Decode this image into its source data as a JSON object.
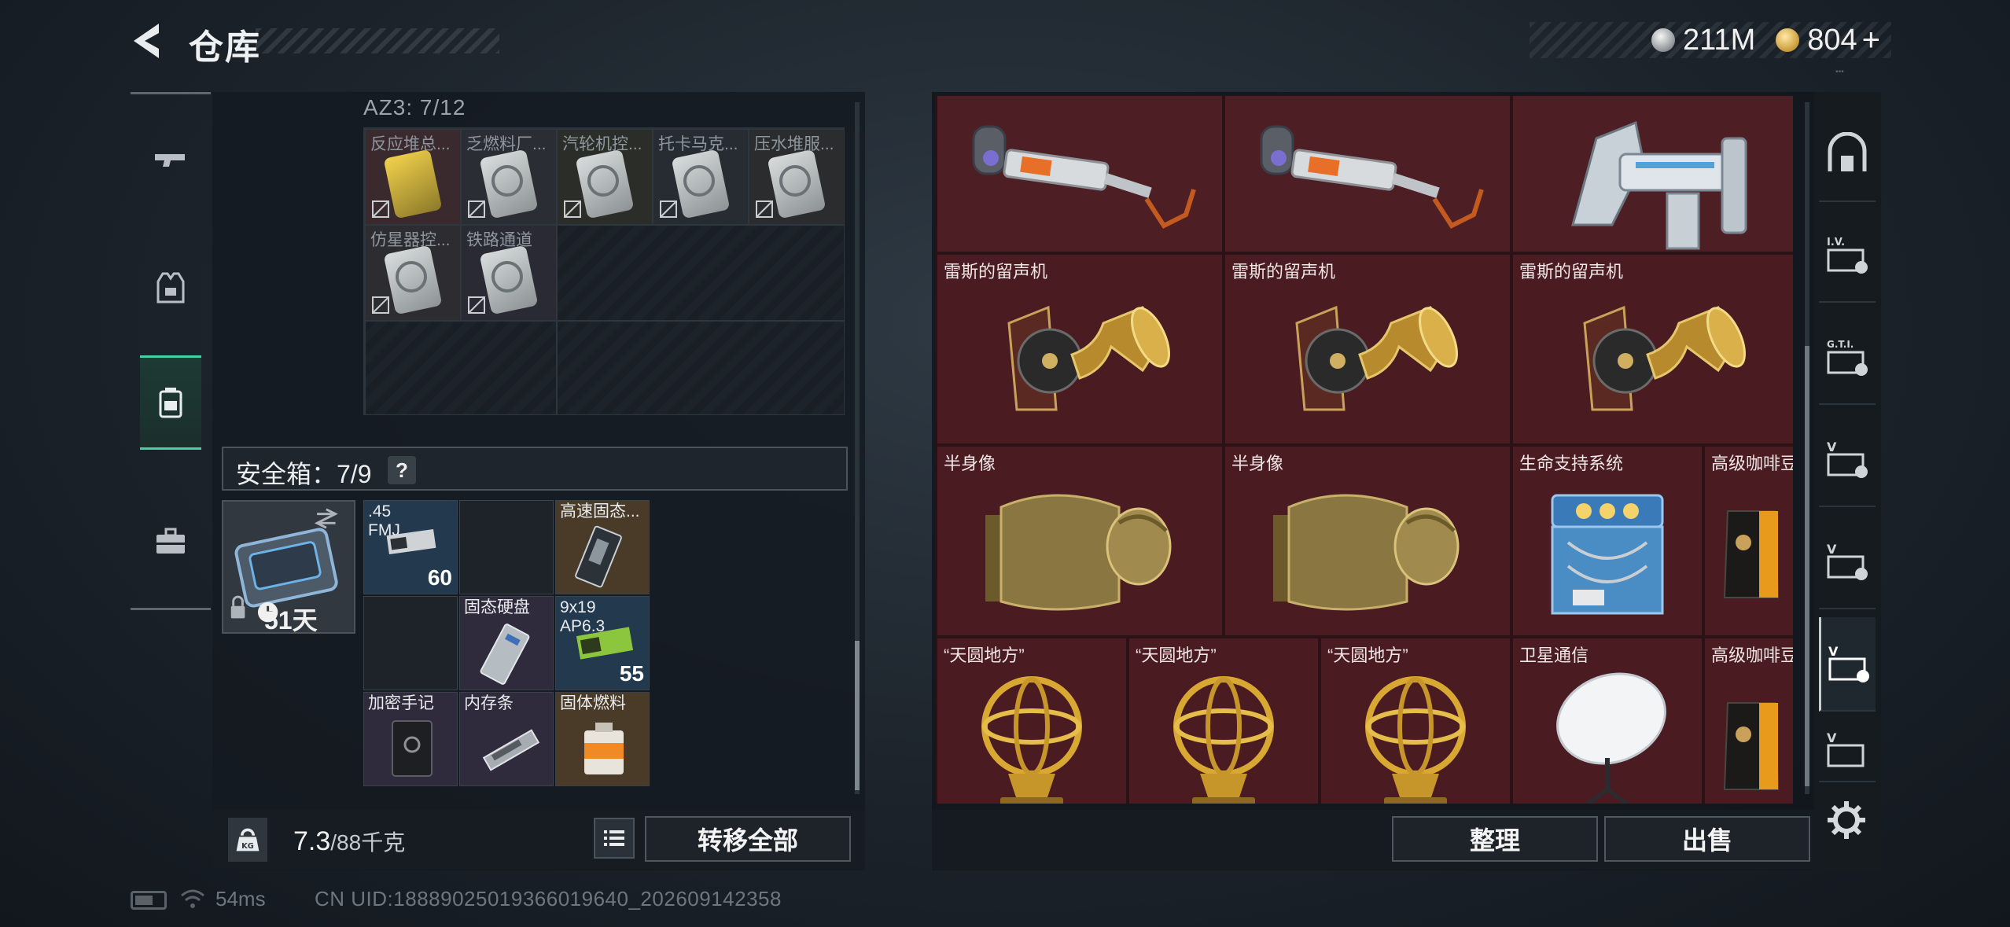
{
  "header": {
    "title": "仓库",
    "currencies": [
      {
        "icon": "silver-coin-icon",
        "value": "211M"
      },
      {
        "icon": "gold-coin-icon",
        "value": "804"
      }
    ],
    "plus": "+"
  },
  "left_rail": [
    {
      "icon": "pistol-icon",
      "active": false
    },
    {
      "icon": "vest-icon",
      "active": false
    },
    {
      "icon": "backpack-icon",
      "active": true
    },
    {
      "icon": "toolbox-icon",
      "active": false
    }
  ],
  "stash": {
    "zone_label": "AZ3: 7/12",
    "keycards": [
      {
        "label": "反应堆总...",
        "color": "yellow"
      },
      {
        "label": "乏燃料厂...",
        "color": "white"
      },
      {
        "label": "汽轮机控...",
        "color": "white"
      },
      {
        "label": "托卡马克...",
        "color": "white"
      },
      {
        "label": "压水堆服...",
        "color": "white"
      },
      {
        "label": "仿星器控...",
        "color": "white"
      },
      {
        "label": "铁路通道",
        "color": "white"
      }
    ]
  },
  "safe_box": {
    "label": "安全箱：7/9",
    "help": "?",
    "case_time": "51天",
    "items": [
      {
        "name": ".45\nFMJ",
        "qty": "60",
        "bg": "blue"
      },
      {
        "name": "",
        "qty": "",
        "bg": "dark"
      },
      {
        "name": "高速固态...",
        "qty": "",
        "bg": "gold"
      },
      {
        "name": "",
        "qty": "",
        "bg": "dark"
      },
      {
        "name": "固态硬盘",
        "qty": "",
        "bg": "purple"
      },
      {
        "name": "9x19\nAP6.3",
        "qty": "55",
        "bg": "blue"
      },
      {
        "name": "加密手记",
        "qty": "",
        "bg": "purple"
      },
      {
        "name": "内存条",
        "qty": "",
        "bg": "purple"
      },
      {
        "name": "固体燃料",
        "qty": "",
        "bg": "gold"
      }
    ]
  },
  "left_footer": {
    "weight_value": "7.3",
    "weight_total": "/88千克",
    "transfer_all": "转移全部"
  },
  "storage": {
    "items": [
      {
        "name": "",
        "type": "arm"
      },
      {
        "name": "",
        "type": "arm"
      },
      {
        "name": "",
        "type": "big-arm"
      },
      {
        "name": "雷斯的留声机",
        "type": "gramophone"
      },
      {
        "name": "雷斯的留声机",
        "type": "gramophone"
      },
      {
        "name": "雷斯的留声机",
        "type": "gramophone"
      },
      {
        "name": "半身像",
        "type": "bust"
      },
      {
        "name": "半身像",
        "type": "bust"
      },
      {
        "name": "生命支持系统",
        "type": "life-support"
      },
      {
        "name": "高级咖啡豆",
        "type": "coffee"
      },
      {
        "name": "“天圆地方”",
        "type": "globe"
      },
      {
        "name": "“天圆地方”",
        "type": "globe"
      },
      {
        "name": "“天圆地方”",
        "type": "globe"
      },
      {
        "name": "卫星通信",
        "type": "satellite"
      },
      {
        "name": "高级咖啡豆",
        "type": "coffee"
      }
    ]
  },
  "right_footer": {
    "sort": "整理",
    "sell": "出售"
  },
  "right_rail": [
    {
      "icon": "home-base-icon",
      "label": ""
    },
    {
      "icon": "container-iv-icon",
      "label": "I.V."
    },
    {
      "icon": "container-gti-icon",
      "label": "G.T.I."
    },
    {
      "icon": "container-v-icon",
      "label": "V"
    },
    {
      "icon": "container-v-icon",
      "label": "V"
    },
    {
      "icon": "container-v-icon",
      "label": "V"
    },
    {
      "icon": "container-v-icon",
      "label": "V"
    }
  ],
  "status": {
    "ping": "54ms",
    "uid": "CN UID:1888902501936601964​0_202609142358"
  },
  "colors": {
    "accent": "#47d0a6",
    "storage_bg": "#4a1d22",
    "panel_bg": "#14191f"
  }
}
